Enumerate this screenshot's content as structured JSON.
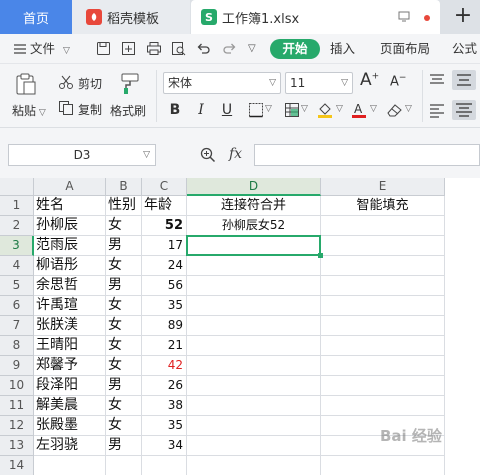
{
  "tabs": {
    "home": "首页",
    "daoke": "稻壳模板",
    "workbook": "工作簿1.xlsx",
    "add": "+"
  },
  "menu": {
    "file": "文件",
    "start": "开始",
    "insert": "插入",
    "page_layout": "页面布局",
    "formula": "公式"
  },
  "ribbon": {
    "paste": "粘贴",
    "cut": "剪切",
    "copy": "复制",
    "format_painter": "格式刷",
    "font_name": "宋体",
    "font_size": "11",
    "bold": "B",
    "italic": "I",
    "underline": "U",
    "grow": "A",
    "shrink": "A"
  },
  "formula_bar": {
    "name_box": "D3",
    "fx": "fx",
    "formula": ""
  },
  "grid": {
    "columns": [
      "A",
      "B",
      "C",
      "D",
      "E"
    ],
    "rows": [
      "1",
      "2",
      "3",
      "4",
      "5",
      "6",
      "7",
      "8",
      "9",
      "10",
      "11",
      "12",
      "13",
      "14"
    ],
    "header_row": {
      "A": "姓名",
      "B": "性别",
      "C": "年龄",
      "D": "连接符合并",
      "E": "智能填充"
    },
    "data": [
      {
        "name": "孙柳辰",
        "gender": "女",
        "age": "52",
        "merge": "孙柳辰女52"
      },
      {
        "name": "范雨辰",
        "gender": "男",
        "age": "17",
        "merge": ""
      },
      {
        "name": "柳语彤",
        "gender": "女",
        "age": "24",
        "merge": ""
      },
      {
        "name": "余思哲",
        "gender": "男",
        "age": "56",
        "merge": ""
      },
      {
        "name": "许禹瑄",
        "gender": "女",
        "age": "35",
        "merge": ""
      },
      {
        "name": "张朕渼",
        "gender": "女",
        "age": "89",
        "merge": ""
      },
      {
        "name": "王晴阳",
        "gender": "女",
        "age": "21",
        "merge": ""
      },
      {
        "name": "郑馨予",
        "gender": "女",
        "age": "42",
        "merge": ""
      },
      {
        "name": "段泽阳",
        "gender": "男",
        "age": "26",
        "merge": ""
      },
      {
        "name": "解美晨",
        "gender": "女",
        "age": "38",
        "merge": ""
      },
      {
        "name": "张殿墨",
        "gender": "女",
        "age": "35",
        "merge": ""
      },
      {
        "name": "左羽骁",
        "gender": "男",
        "age": "34",
        "merge": ""
      }
    ],
    "selected_cell": "D3"
  },
  "colors": {
    "accent": "#27a96b",
    "home_tab": "#4a86e8",
    "red_age": "#e02020"
  },
  "watermark": "Bai 经验"
}
